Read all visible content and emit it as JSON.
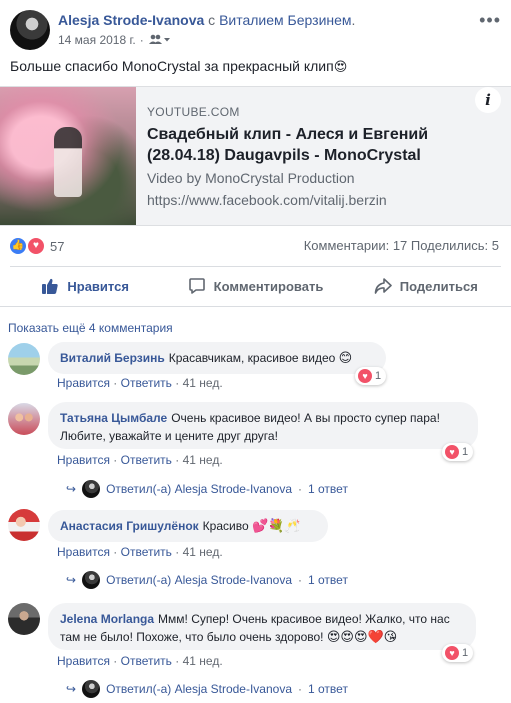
{
  "post": {
    "author": "Alesja Strode-Ivanova",
    "with_prefix": "с",
    "tagged": "Виталием Берзинем",
    "tagged_suffix": ".",
    "date": "14 мая 2018 г.",
    "audience_icon": "friends-icon",
    "text": "Больше спасибо MonoCrystal за прекрасный клип",
    "text_emoji": "😍"
  },
  "card": {
    "source": "YOUTUBE.COM",
    "title": "Свадебный клип - Алеся и Евгений (28.04.18) Daugavpils - MonoCrystal",
    "desc_line1": "Video by MonoCrystal Production",
    "desc_line2": "https://www.facebook.com/vitalij.berzin",
    "info_label": "i"
  },
  "reactions": {
    "count": "57",
    "stats": "Комментарии: 17   Поделились: 5"
  },
  "actions": {
    "like": "Нравится",
    "comment": "Комментировать",
    "share": "Поделиться"
  },
  "more_comments": "Показать ещё 4 комментария",
  "comments": [
    {
      "name": "Виталий Берзинь",
      "text": "Красавчикам, красивое видео",
      "emoji": "😊",
      "like": "Нравится",
      "reply": "Ответить",
      "time": "41 нед.",
      "reactions": "1"
    },
    {
      "name": "Татьяна Цымбале",
      "text": "Очень красивое видео! А вы просто супер пара! Любите, уважайте и цените друг друга!",
      "like": "Нравится",
      "reply": "Ответить",
      "time": "41 нед.",
      "reactions": "1",
      "replies_by": "Ответил(-а) Alesja Strode-Ivanova",
      "replies_count": "1 ответ"
    },
    {
      "name": "Анастасия Гришулёнок",
      "text": "Красиво",
      "emoji": "💕💐🥂",
      "like": "Нравится",
      "reply": "Ответить",
      "time": "41 нед.",
      "replies_by": "Ответил(-а) Alesja Strode-Ivanova",
      "replies_count": "1 ответ"
    },
    {
      "name": "Jelena Morlanga",
      "text": "Ммм! Супер! Очень красивое видео! Жалко, что нас там не было! Похоже, что было очень здорово!",
      "emoji": "😍😍😍❤️😘",
      "like": "Нравится",
      "reply": "Ответить",
      "time": "41 нед.",
      "reactions": "1",
      "replies_by": "Ответил(-а) Alesja Strode-Ivanova",
      "replies_count": "1 ответ"
    }
  ],
  "colors": {
    "link_blue": "#385898",
    "like_blue": "#3b7df5",
    "love_red": "#f25268",
    "bubble_bg": "#f2f3f5"
  }
}
